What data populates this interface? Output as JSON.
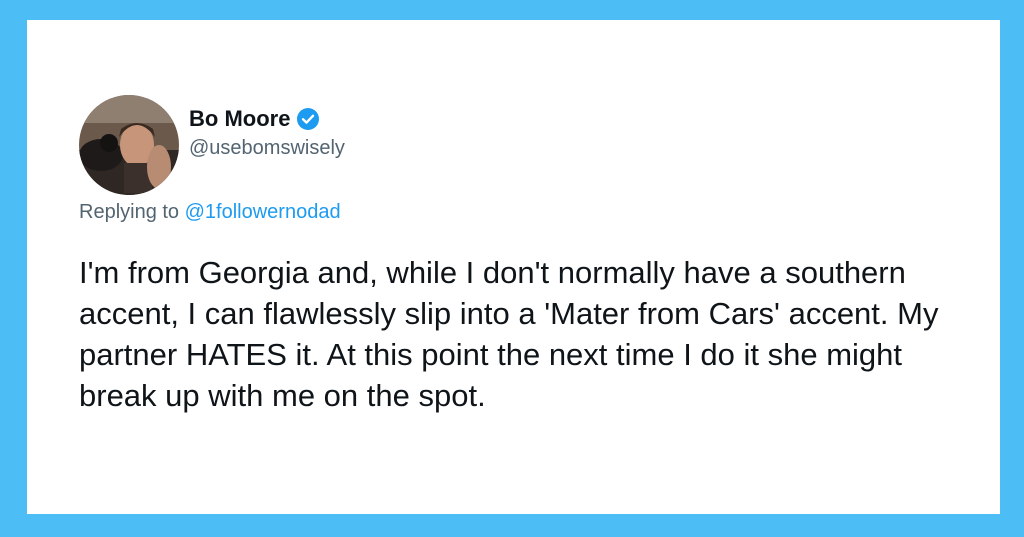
{
  "tweet": {
    "display_name": "Bo Moore",
    "handle": "@usebomswisely",
    "verified": true,
    "reply_prefix": "Replying to",
    "reply_mention": "@1followernodad",
    "text": "I'm from Georgia and, while I don't normally have a southern accent, I can flawlessly slip into a 'Mater from Cars' accent. My partner HATES it. At this point the next time I do it she might break up with me on the spot."
  },
  "icons": {
    "verified": "verified-badge-icon",
    "avatar": "profile-avatar"
  },
  "colors": {
    "background": "#4dbef5",
    "card": "#ffffff",
    "text": "#0f1419",
    "secondary_text": "#536471",
    "link": "#1d9bf0",
    "verified_badge": "#1d9bf0"
  }
}
